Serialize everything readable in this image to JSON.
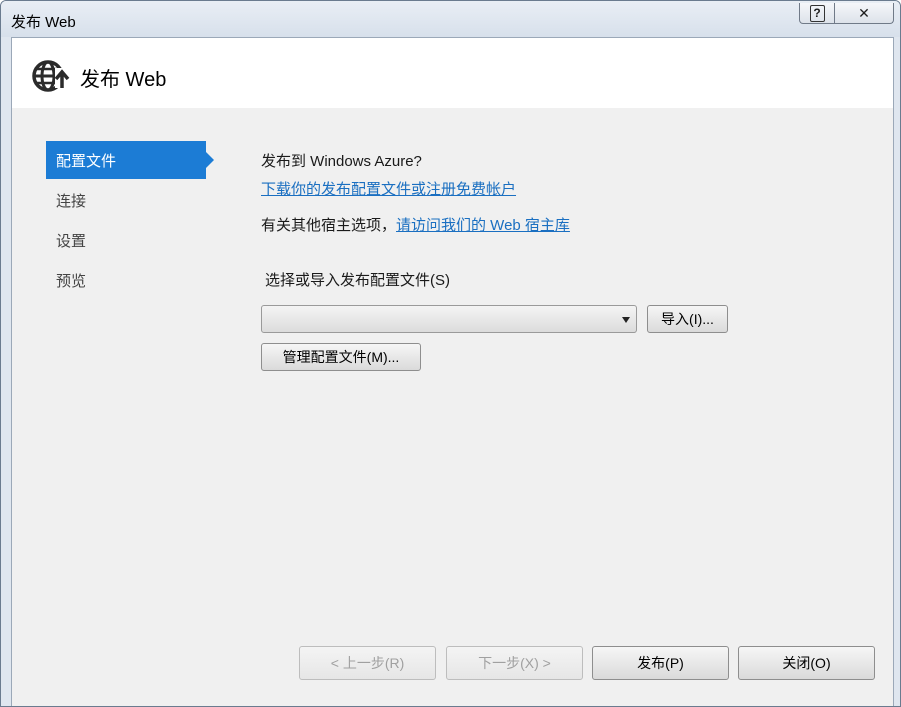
{
  "window": {
    "title": "发布 Web"
  },
  "titlebar": {
    "help_label": "?",
    "close_label": "✕"
  },
  "header": {
    "title": "发布 Web",
    "icon": "globe-upload-icon"
  },
  "sidebar": {
    "items": [
      {
        "label": "配置文件",
        "active": true
      },
      {
        "label": "连接",
        "active": false
      },
      {
        "label": "设置",
        "active": false
      },
      {
        "label": "预览",
        "active": false
      }
    ]
  },
  "main": {
    "azure_question": "发布到 Windows Azure?",
    "azure_link": "下载你的发布配置文件或注册免费帐户",
    "other_hosting_prefix": "有关其他宿主选项，",
    "other_hosting_link": "请访问我们的 Web 宿主库",
    "profile_label": "选择或导入发布配置文件(S)",
    "profile_select_value": "",
    "import_button": "导入(I)...",
    "manage_button": "管理配置文件(M)..."
  },
  "footer": {
    "prev_button": "< 上一步(R)",
    "next_button": "下一步(X) >",
    "publish_button": "发布(P)",
    "close_button": "关闭(O)"
  },
  "colors": {
    "accent": "#1c7cd5",
    "link": "#1a6fc1"
  }
}
